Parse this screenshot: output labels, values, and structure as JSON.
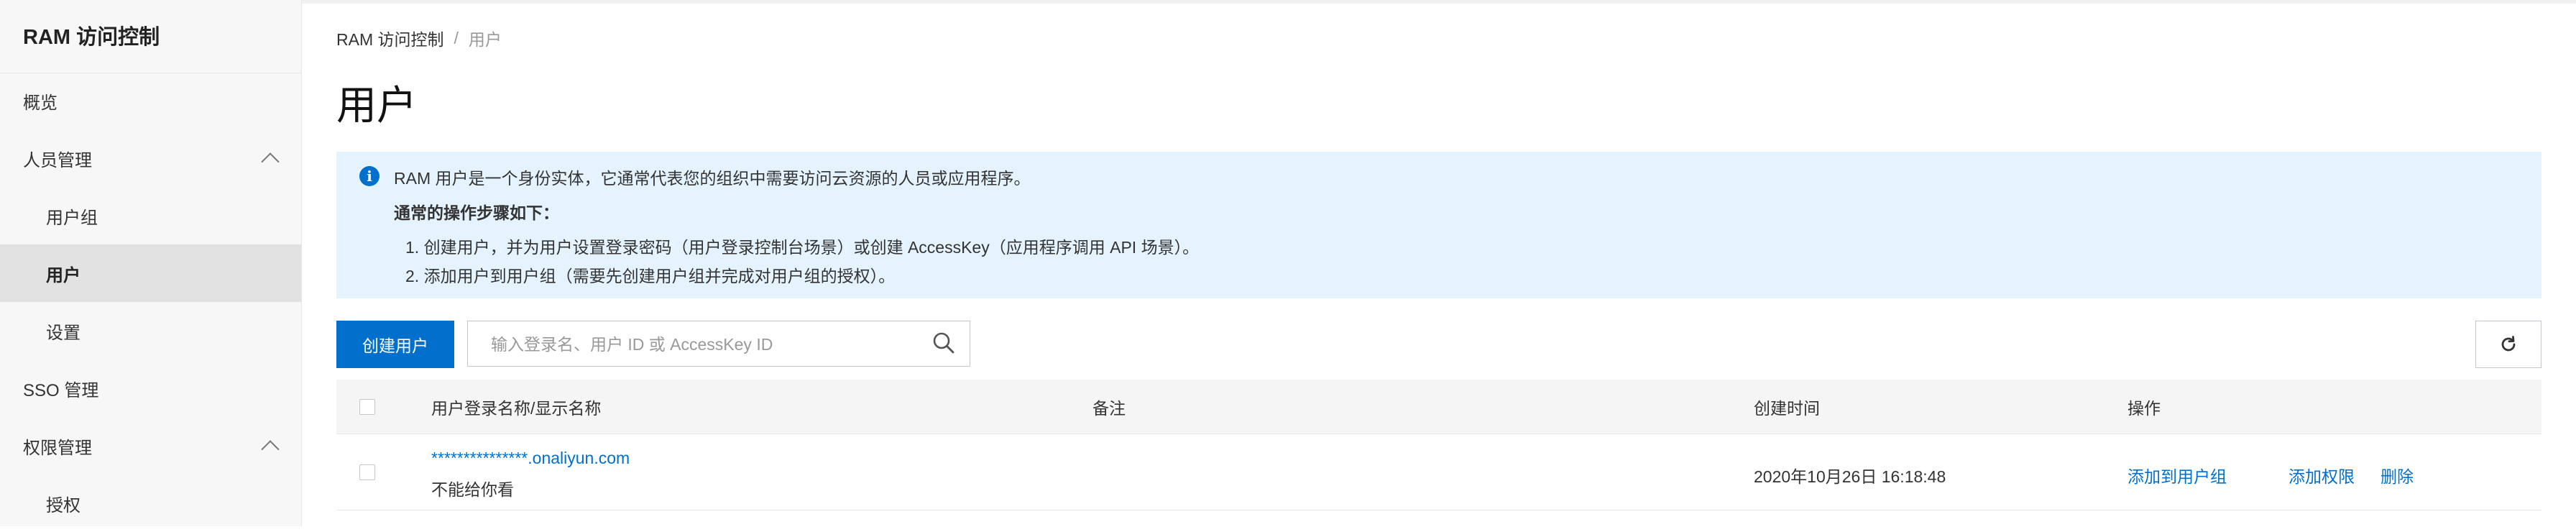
{
  "sidebar": {
    "title": "RAM 访问控制",
    "items": [
      {
        "label": "概览"
      },
      {
        "label": "人员管理"
      },
      {
        "label": "用户组"
      },
      {
        "label": "用户"
      },
      {
        "label": "设置"
      },
      {
        "label": "SSO 管理"
      },
      {
        "label": "权限管理"
      },
      {
        "label": "授权"
      }
    ]
  },
  "breadcrumb": {
    "root": "RAM 访问控制",
    "separator": "/",
    "current": "用户"
  },
  "page_title": "用户",
  "info": {
    "line1": "RAM 用户是一个身份实体，它通常代表您的组织中需要访问云资源的人员或应用程序。",
    "heading": "通常的操作步骤如下：",
    "step1": "1. 创建用户，并为用户设置登录密码（用户登录控制台场景）或创建 AccessKey（应用程序调用 API 场景）。",
    "step2": "2. 添加用户到用户组（需要先创建用户组并完成对用户组的授权）。"
  },
  "toolbar": {
    "create_label": "创建用户",
    "search_placeholder": "输入登录名、用户 ID 或 AccessKey ID",
    "search_value": ""
  },
  "table": {
    "columns": {
      "name": "用户登录名称/显示名称",
      "note": "备注",
      "created": "创建时间",
      "actions": "操作"
    },
    "rows": [
      {
        "login_name": "***************.onaliyun.com",
        "display_name": "不能给你看",
        "note": "",
        "created": "2020年10月26日 16:18:48",
        "action_add_group": "添加到用户组",
        "action_add_perm": "添加权限",
        "action_delete": "删除"
      }
    ]
  },
  "colors": {
    "accent": "#0070cc",
    "info_bg": "#e5f3fe",
    "brand": "#ff6a00"
  }
}
